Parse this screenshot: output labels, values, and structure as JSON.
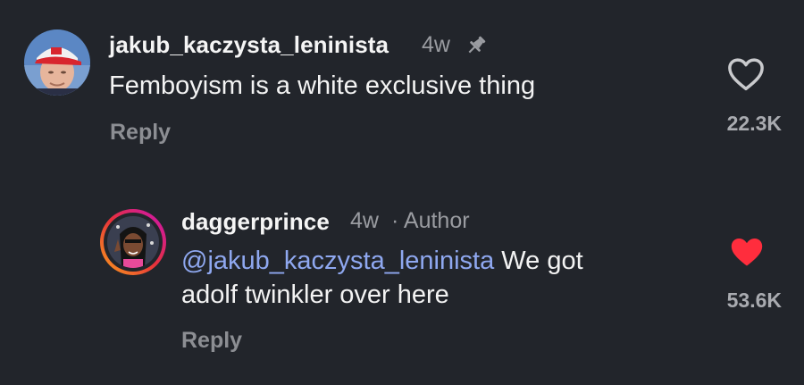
{
  "comments": [
    {
      "username": "jakub_kaczysta_leninista",
      "age": "4w",
      "text": "Femboyism is a white exclusive thing",
      "reply_label": "Reply",
      "like_count": "22.3K",
      "liked": false,
      "pinned": true,
      "icons": {
        "pin": "pin-icon",
        "like": "heart-outline-icon"
      }
    },
    {
      "username": "daggerprince",
      "age": "4w",
      "author_label": "· Author",
      "mention": "@jakub_kaczysta_leninista",
      "text_line1": " We got",
      "text_line2": "adolf twinkler over here",
      "reply_label": "Reply",
      "like_count": "53.6K",
      "liked": true,
      "icons": {
        "like": "heart-filled-icon"
      }
    }
  ],
  "colors": {
    "background": "#22252b",
    "mention": "#8fa8f0",
    "liked_heart": "#ff2d3d",
    "story_ring_start": "#f9a11b",
    "story_ring_end": "#c913b9"
  }
}
